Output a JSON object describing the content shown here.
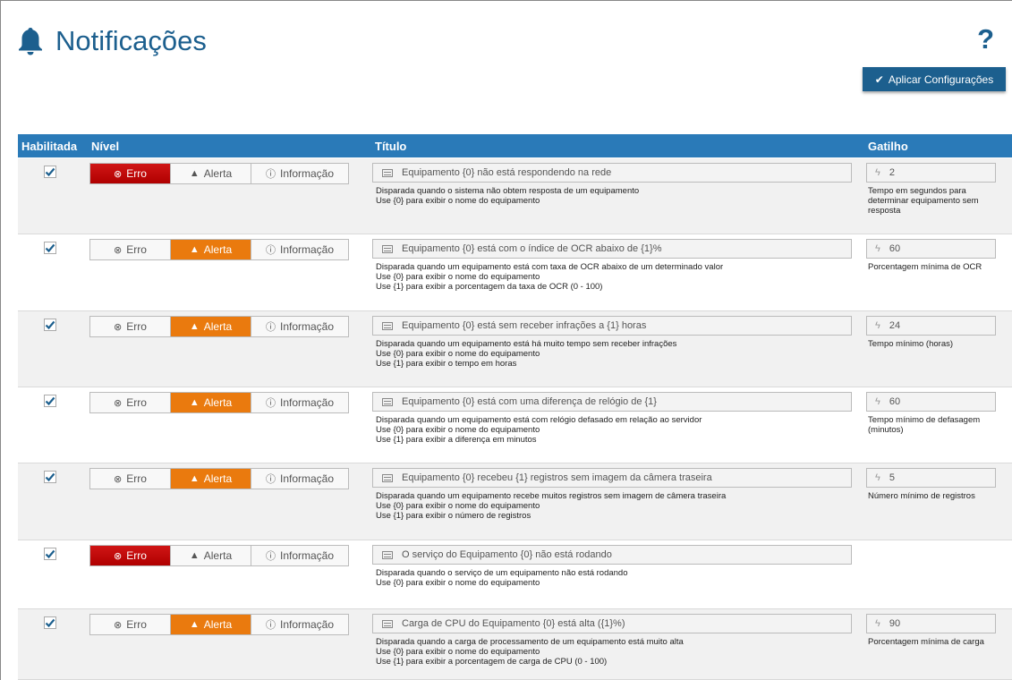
{
  "page": {
    "title": "Notificações",
    "help": "?"
  },
  "toolbar": {
    "apply_label": "Aplicar Configurações"
  },
  "columns": {
    "enabled": "Habilitada",
    "level": "Nível",
    "title": "Título",
    "trigger": "Gatilho"
  },
  "levels": {
    "error": "Erro",
    "alert": "Alerta",
    "info": "Informação"
  },
  "colors": {
    "accent": "#1c5f8e",
    "header": "#2a7ab8",
    "error": "#c40d0d",
    "alert": "#ea7a0e"
  },
  "rows": [
    {
      "enabled": true,
      "level": "error",
      "title": "Equipamento {0} não está respondendo na rede",
      "desc": [
        "Disparada quando o sistema não obtem resposta de um equipamento",
        "Use {0} para exibir o nome do equipamento"
      ],
      "trigger_value": "2",
      "trigger_desc": "Tempo em segundos para determinar equipamento sem resposta"
    },
    {
      "enabled": true,
      "level": "alert",
      "title": "Equipamento {0} está com o índice de OCR abaixo de {1}%",
      "desc": [
        "Disparada quando um equipamento está com taxa de OCR abaixo de um determinado valor",
        "Use {0} para exibir o nome do equipamento",
        "Use {1} para exibir a porcentagem da taxa de OCR (0 - 100)"
      ],
      "trigger_value": "60",
      "trigger_desc": "Porcentagem mínima de OCR"
    },
    {
      "enabled": true,
      "level": "alert",
      "title": "Equipamento {0} está sem receber infrações a {1} horas",
      "desc": [
        "Disparada quando um equipamento está há muito tempo sem receber infrações",
        "Use {0} para exibir o nome do equipamento",
        "Use {1} para exibir o tempo em horas"
      ],
      "trigger_value": "24",
      "trigger_desc": "Tempo mínimo (horas)"
    },
    {
      "enabled": true,
      "level": "alert",
      "title": "Equipamento {0} está com uma diferença de relógio de {1}",
      "desc": [
        "Disparada quando um equipamento está com relógio defasado em relação ao servidor",
        "Use {0} para exibir o nome do equipamento",
        "Use {1} para exibir a diferença em minutos"
      ],
      "trigger_value": "60",
      "trigger_desc": "Tempo mínimo de defasagem (minutos)"
    },
    {
      "enabled": true,
      "level": "alert",
      "title": "Equipamento {0} recebeu {1} registros sem imagem da câmera traseira",
      "desc": [
        "Disparada quando um equipamento recebe muitos registros sem imagem de câmera traseira",
        "Use {0} para exibir o nome do equipamento",
        "Use {1} para exibir o número de registros"
      ],
      "trigger_value": "5",
      "trigger_desc": "Número mínimo de registros"
    },
    {
      "enabled": true,
      "level": "error",
      "title": "O serviço do Equipamento {0} não está rodando",
      "desc": [
        "Disparada quando o serviço de um equipamento não está rodando",
        "Use {0} para exibir o nome do equipamento"
      ],
      "trigger_value": null,
      "trigger_desc": null
    },
    {
      "enabled": true,
      "level": "alert",
      "title": "Carga de CPU do Equipamento {0} está alta ({1}%)",
      "desc": [
        "Disparada quando a carga de processamento de um equipamento está muito alta",
        "Use {0} para exibir o nome do equipamento",
        "Use {1} para exibir a porcentagem de carga de CPU (0 - 100)"
      ],
      "trigger_value": "90",
      "trigger_desc": "Porcentagem mínima de carga"
    }
  ]
}
